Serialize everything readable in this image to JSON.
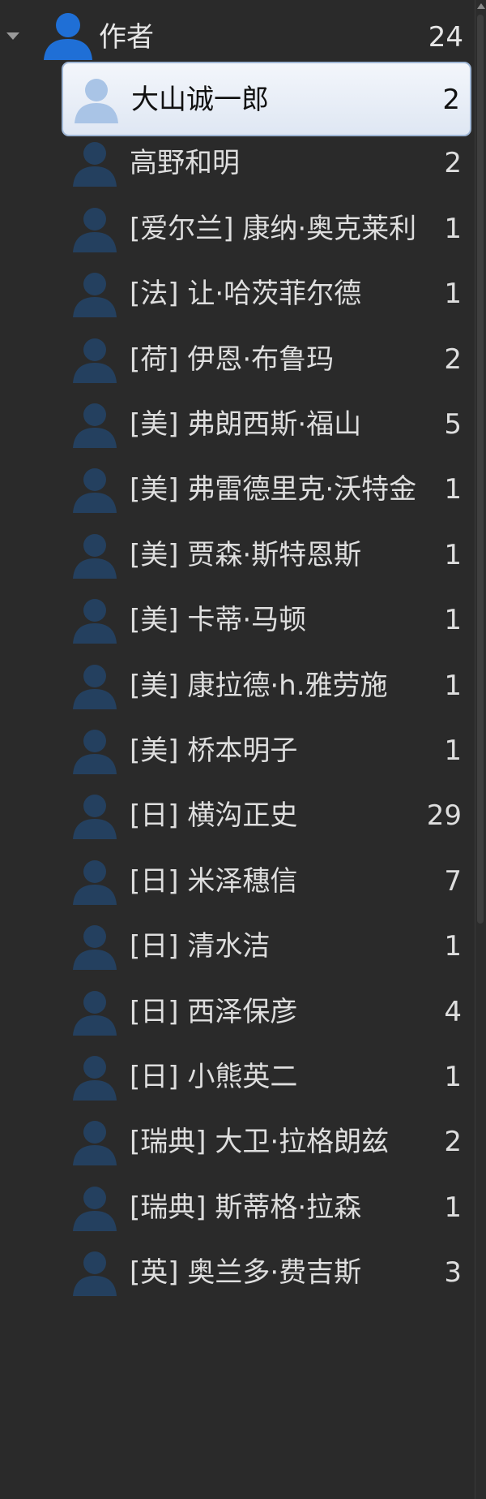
{
  "root": {
    "label": "作者",
    "count": "24",
    "icon": "person-icon",
    "expanded": true
  },
  "authors": [
    {
      "name": "大山诚一郎",
      "count": "2",
      "selected": true
    },
    {
      "name": "高野和明",
      "count": "2"
    },
    {
      "name": "[爱尔兰] 康纳·奥克莱利",
      "count": "1"
    },
    {
      "name": "[法] 让·哈茨菲尔德",
      "count": "1"
    },
    {
      "name": "[荷] 伊恩·布鲁玛",
      "count": "2"
    },
    {
      "name": "[美] 弗朗西斯·福山",
      "count": "5"
    },
    {
      "name": "[美] 弗雷德里克·沃特金",
      "count": "1"
    },
    {
      "name": "[美] 贾森·斯特恩斯",
      "count": "1"
    },
    {
      "name": "[美] 卡蒂·马顿",
      "count": "1"
    },
    {
      "name": "[美] 康拉德·h.雅劳施",
      "count": "1"
    },
    {
      "name": "[美] 桥本明子",
      "count": "1"
    },
    {
      "name": "[日] 横沟正史",
      "count": "29"
    },
    {
      "name": "[日] 米泽穗信",
      "count": "7"
    },
    {
      "name": "[日] 清水洁",
      "count": "1"
    },
    {
      "name": "[日] 西泽保彦",
      "count": "4"
    },
    {
      "name": "[日] 小熊英二",
      "count": "1"
    },
    {
      "name": "[瑞典] 大卫·拉格朗兹",
      "count": "2"
    },
    {
      "name": "[瑞典] 斯蒂格·拉森",
      "count": "1"
    },
    {
      "name": "[英] 奥兰多·费吉斯",
      "count": "3"
    }
  ],
  "colors": {
    "background": "#2a2a2a",
    "person_icon_root": "#1f6fd6",
    "person_icon_item": "#24405f",
    "person_icon_selected": "#a9c4e6",
    "selection_bg": "#e8eef7"
  }
}
